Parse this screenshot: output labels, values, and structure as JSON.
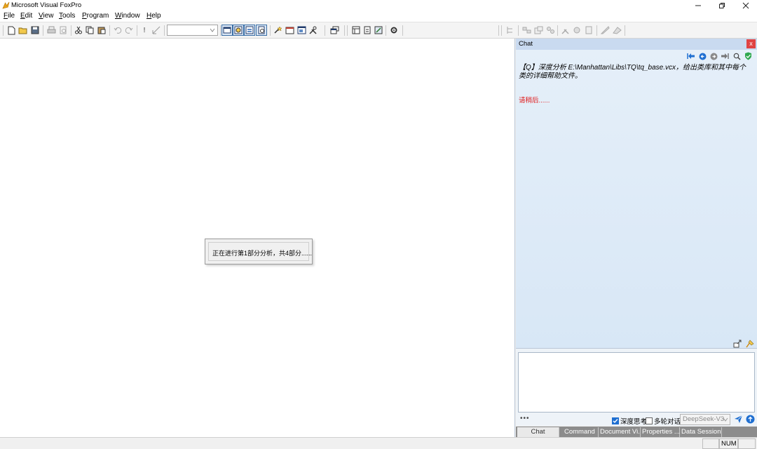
{
  "window": {
    "title": "Microsoft Visual FoxPro",
    "controls": {
      "minimize": "—",
      "restore": "❐",
      "close": "✕"
    }
  },
  "menubar": {
    "items": [
      {
        "label": "File"
      },
      {
        "label": "Edit"
      },
      {
        "label": "View"
      },
      {
        "label": "Tools"
      },
      {
        "label": "Program"
      },
      {
        "label": "Window"
      },
      {
        "label": "Help"
      }
    ]
  },
  "toolbar": {
    "combo_value": "",
    "icons": [
      "new-file-icon",
      "open-folder-icon",
      "save-icon",
      "print-icon",
      "print-preview-icon",
      "cut-icon",
      "copy-icon",
      "paste-icon",
      "undo-icon",
      "redo-icon",
      "run-icon",
      "modify-form-icon",
      "command-window-icon",
      "data-session-icon",
      "form-designer-icon",
      "report-designer-icon",
      "wizard-icon",
      "code-references-icon",
      "toolbox-icon",
      "properties-icon",
      "layout-icon",
      "form-icon",
      "builder-icon",
      "settings-icon"
    ]
  },
  "progress_dialog": {
    "text": "正在进行第1部分分析，共4部分......"
  },
  "chat": {
    "title": "Chat",
    "close_label": "x",
    "question": "【Q】深度分析 E:\\Manhattan\\Libs\\TQ\\tq_base.vcx，给出类库和其中每个类的详细帮助文件。",
    "waiting": "请稍后......",
    "input_value": "",
    "more_label": "•••",
    "deep_think_label": "深度思考",
    "deep_think_checked": true,
    "multi_turn_label": "多轮对话",
    "multi_turn_checked": false,
    "model": "DeepSeek-V3",
    "tabs": [
      {
        "label": "Chat",
        "active": true
      },
      {
        "label": "Command",
        "active": false
      },
      {
        "label": "Document Vi...",
        "active": false
      },
      {
        "label": "Properties ...",
        "active": false
      },
      {
        "label": "Data Session",
        "active": false
      }
    ]
  },
  "statusbar": {
    "num": "NUM"
  },
  "colors": {
    "accent": "#1f6fd1",
    "chat_header": "#c9daf0",
    "waiting_text": "#e01818",
    "close_red": "#e04343"
  }
}
